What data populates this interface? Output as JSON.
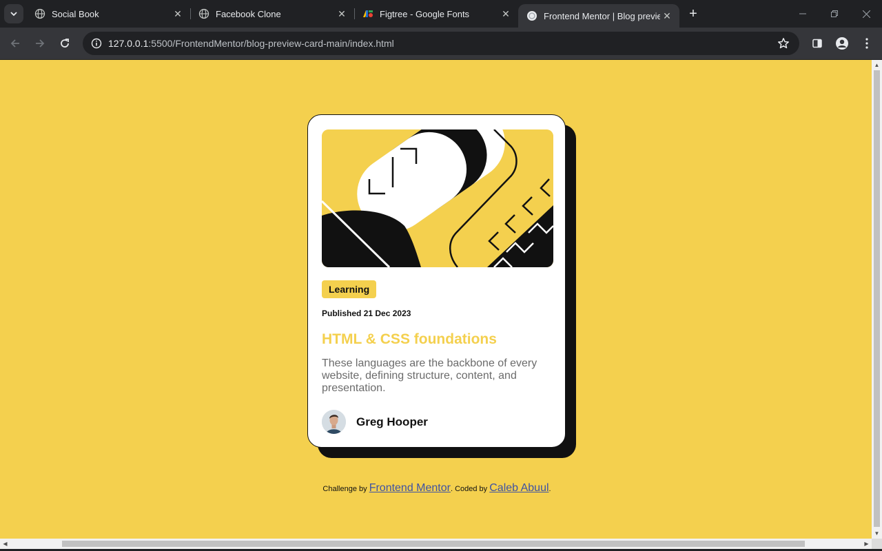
{
  "browser": {
    "tabs": [
      {
        "title": "Social Book",
        "icon": "globe-icon"
      },
      {
        "title": "Facebook Clone",
        "icon": "globe-icon"
      },
      {
        "title": "Figtree - Google Fonts",
        "icon": "google-fonts-icon"
      },
      {
        "title": "Frontend Mentor | Blog preview card",
        "icon": "page-icon",
        "active": true
      }
    ],
    "url_host": "127.0.0.1",
    "url_rest": ":5500/FrontendMentor/blog-preview-card-main/index.html"
  },
  "card": {
    "category": "Learning",
    "published_label": "Published",
    "published_date": "21 Dec 2023",
    "title": "HTML & CSS foundations",
    "description": "These languages are the backbone of every website, defining structure, content, and presentation.",
    "author": "Greg Hooper"
  },
  "attribution": {
    "prefix": "Challenge by",
    "link1": "Frontend Mentor",
    "middle": ". Coded by",
    "link2": "Caleb Abuul",
    "suffix": "."
  },
  "colors": {
    "background": "#f4d04e",
    "accent": "#f4d04e",
    "dark": "#111111",
    "link": "#3e52a3"
  }
}
